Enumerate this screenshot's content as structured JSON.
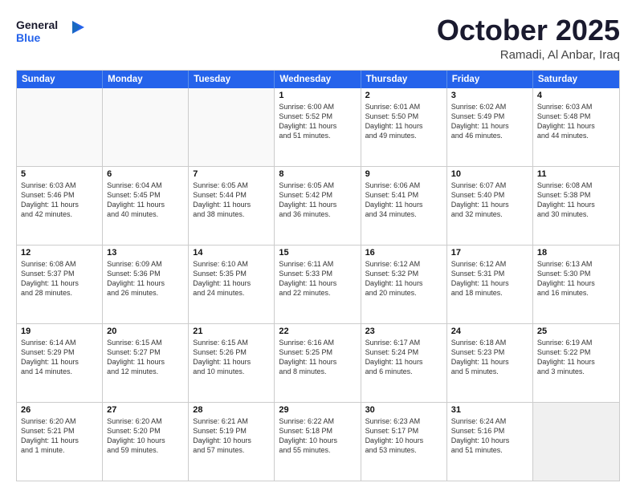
{
  "header": {
    "logo_general": "General",
    "logo_blue": "Blue",
    "month_title": "October 2025",
    "location": "Ramadi, Al Anbar, Iraq"
  },
  "weekdays": [
    "Sunday",
    "Monday",
    "Tuesday",
    "Wednesday",
    "Thursday",
    "Friday",
    "Saturday"
  ],
  "weeks": [
    [
      {
        "day": "",
        "lines": []
      },
      {
        "day": "",
        "lines": []
      },
      {
        "day": "",
        "lines": []
      },
      {
        "day": "1",
        "lines": [
          "Sunrise: 6:00 AM",
          "Sunset: 5:52 PM",
          "Daylight: 11 hours",
          "and 51 minutes."
        ]
      },
      {
        "day": "2",
        "lines": [
          "Sunrise: 6:01 AM",
          "Sunset: 5:50 PM",
          "Daylight: 11 hours",
          "and 49 minutes."
        ]
      },
      {
        "day": "3",
        "lines": [
          "Sunrise: 6:02 AM",
          "Sunset: 5:49 PM",
          "Daylight: 11 hours",
          "and 46 minutes."
        ]
      },
      {
        "day": "4",
        "lines": [
          "Sunrise: 6:03 AM",
          "Sunset: 5:48 PM",
          "Daylight: 11 hours",
          "and 44 minutes."
        ]
      }
    ],
    [
      {
        "day": "5",
        "lines": [
          "Sunrise: 6:03 AM",
          "Sunset: 5:46 PM",
          "Daylight: 11 hours",
          "and 42 minutes."
        ]
      },
      {
        "day": "6",
        "lines": [
          "Sunrise: 6:04 AM",
          "Sunset: 5:45 PM",
          "Daylight: 11 hours",
          "and 40 minutes."
        ]
      },
      {
        "day": "7",
        "lines": [
          "Sunrise: 6:05 AM",
          "Sunset: 5:44 PM",
          "Daylight: 11 hours",
          "and 38 minutes."
        ]
      },
      {
        "day": "8",
        "lines": [
          "Sunrise: 6:05 AM",
          "Sunset: 5:42 PM",
          "Daylight: 11 hours",
          "and 36 minutes."
        ]
      },
      {
        "day": "9",
        "lines": [
          "Sunrise: 6:06 AM",
          "Sunset: 5:41 PM",
          "Daylight: 11 hours",
          "and 34 minutes."
        ]
      },
      {
        "day": "10",
        "lines": [
          "Sunrise: 6:07 AM",
          "Sunset: 5:40 PM",
          "Daylight: 11 hours",
          "and 32 minutes."
        ]
      },
      {
        "day": "11",
        "lines": [
          "Sunrise: 6:08 AM",
          "Sunset: 5:38 PM",
          "Daylight: 11 hours",
          "and 30 minutes."
        ]
      }
    ],
    [
      {
        "day": "12",
        "lines": [
          "Sunrise: 6:08 AM",
          "Sunset: 5:37 PM",
          "Daylight: 11 hours",
          "and 28 minutes."
        ]
      },
      {
        "day": "13",
        "lines": [
          "Sunrise: 6:09 AM",
          "Sunset: 5:36 PM",
          "Daylight: 11 hours",
          "and 26 minutes."
        ]
      },
      {
        "day": "14",
        "lines": [
          "Sunrise: 6:10 AM",
          "Sunset: 5:35 PM",
          "Daylight: 11 hours",
          "and 24 minutes."
        ]
      },
      {
        "day": "15",
        "lines": [
          "Sunrise: 6:11 AM",
          "Sunset: 5:33 PM",
          "Daylight: 11 hours",
          "and 22 minutes."
        ]
      },
      {
        "day": "16",
        "lines": [
          "Sunrise: 6:12 AM",
          "Sunset: 5:32 PM",
          "Daylight: 11 hours",
          "and 20 minutes."
        ]
      },
      {
        "day": "17",
        "lines": [
          "Sunrise: 6:12 AM",
          "Sunset: 5:31 PM",
          "Daylight: 11 hours",
          "and 18 minutes."
        ]
      },
      {
        "day": "18",
        "lines": [
          "Sunrise: 6:13 AM",
          "Sunset: 5:30 PM",
          "Daylight: 11 hours",
          "and 16 minutes."
        ]
      }
    ],
    [
      {
        "day": "19",
        "lines": [
          "Sunrise: 6:14 AM",
          "Sunset: 5:29 PM",
          "Daylight: 11 hours",
          "and 14 minutes."
        ]
      },
      {
        "day": "20",
        "lines": [
          "Sunrise: 6:15 AM",
          "Sunset: 5:27 PM",
          "Daylight: 11 hours",
          "and 12 minutes."
        ]
      },
      {
        "day": "21",
        "lines": [
          "Sunrise: 6:15 AM",
          "Sunset: 5:26 PM",
          "Daylight: 11 hours",
          "and 10 minutes."
        ]
      },
      {
        "day": "22",
        "lines": [
          "Sunrise: 6:16 AM",
          "Sunset: 5:25 PM",
          "Daylight: 11 hours",
          "and 8 minutes."
        ]
      },
      {
        "day": "23",
        "lines": [
          "Sunrise: 6:17 AM",
          "Sunset: 5:24 PM",
          "Daylight: 11 hours",
          "and 6 minutes."
        ]
      },
      {
        "day": "24",
        "lines": [
          "Sunrise: 6:18 AM",
          "Sunset: 5:23 PM",
          "Daylight: 11 hours",
          "and 5 minutes."
        ]
      },
      {
        "day": "25",
        "lines": [
          "Sunrise: 6:19 AM",
          "Sunset: 5:22 PM",
          "Daylight: 11 hours",
          "and 3 minutes."
        ]
      }
    ],
    [
      {
        "day": "26",
        "lines": [
          "Sunrise: 6:20 AM",
          "Sunset: 5:21 PM",
          "Daylight: 11 hours",
          "and 1 minute."
        ]
      },
      {
        "day": "27",
        "lines": [
          "Sunrise: 6:20 AM",
          "Sunset: 5:20 PM",
          "Daylight: 10 hours",
          "and 59 minutes."
        ]
      },
      {
        "day": "28",
        "lines": [
          "Sunrise: 6:21 AM",
          "Sunset: 5:19 PM",
          "Daylight: 10 hours",
          "and 57 minutes."
        ]
      },
      {
        "day": "29",
        "lines": [
          "Sunrise: 6:22 AM",
          "Sunset: 5:18 PM",
          "Daylight: 10 hours",
          "and 55 minutes."
        ]
      },
      {
        "day": "30",
        "lines": [
          "Sunrise: 6:23 AM",
          "Sunset: 5:17 PM",
          "Daylight: 10 hours",
          "and 53 minutes."
        ]
      },
      {
        "day": "31",
        "lines": [
          "Sunrise: 6:24 AM",
          "Sunset: 5:16 PM",
          "Daylight: 10 hours",
          "and 51 minutes."
        ]
      },
      {
        "day": "",
        "lines": []
      }
    ]
  ]
}
